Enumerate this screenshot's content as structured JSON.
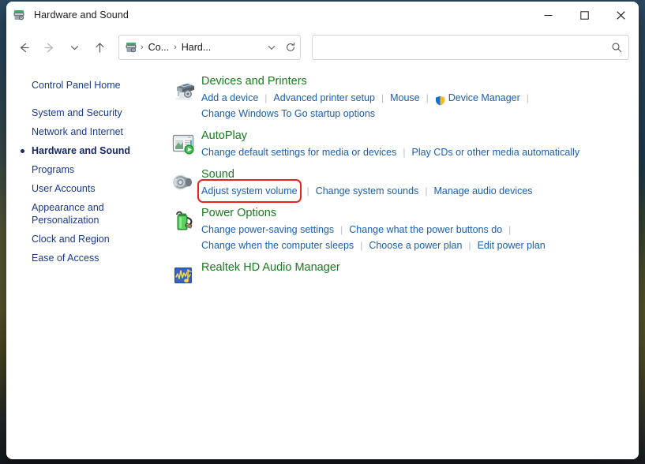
{
  "window": {
    "title": "Hardware and Sound",
    "app_icon": "printer-camera-icon",
    "controls": {
      "minimize": "—",
      "maximize": "☐",
      "close": "✕"
    }
  },
  "toolbar": {
    "back": "back-arrow",
    "forward": "forward-arrow",
    "recent": "recent-locations-chevron",
    "up": "up-arrow",
    "breadcrumb": {
      "icon": "printer-camera-icon",
      "items": [
        "Co...",
        "Hard..."
      ],
      "separator": "›",
      "chevron": "⌄",
      "refresh": "refresh-icon"
    },
    "search": {
      "value": "",
      "placeholder": "",
      "icon": "search-icon"
    }
  },
  "sidebar": {
    "items": [
      {
        "label": "Control Panel Home",
        "selected": false,
        "home": true
      },
      {
        "label": "System and Security",
        "selected": false
      },
      {
        "label": "Network and Internet",
        "selected": false
      },
      {
        "label": "Hardware and Sound",
        "selected": true
      },
      {
        "label": "Programs",
        "selected": false
      },
      {
        "label": "User Accounts",
        "selected": false
      },
      {
        "label": "Appearance and\nPersonalization",
        "selected": false
      },
      {
        "label": "Clock and Region",
        "selected": false
      },
      {
        "label": "Ease of Access",
        "selected": false
      }
    ]
  },
  "main": {
    "categories": [
      {
        "title": "Devices and Printers",
        "icon": "printer-device-icon",
        "rows": [
          [
            {
              "label": "Add a device"
            },
            {
              "label": "Advanced printer setup"
            },
            {
              "label": "Mouse"
            },
            {
              "label": "Device Manager",
              "shield": true
            }
          ],
          [
            {
              "label": "Change Windows To Go startup options"
            }
          ]
        ]
      },
      {
        "title": "AutoPlay",
        "icon": "autoplay-icon",
        "rows": [
          [
            {
              "label": "Change default settings for media or devices"
            },
            {
              "label": "Play CDs or other media automatically"
            }
          ]
        ]
      },
      {
        "title": "Sound",
        "icon": "speaker-icon",
        "rows": [
          [
            {
              "label": "Adjust system volume",
              "highlighted": true
            },
            {
              "label": "Change system sounds"
            },
            {
              "label": "Manage audio devices"
            }
          ]
        ]
      },
      {
        "title": "Power Options",
        "icon": "battery-power-icon",
        "rows": [
          [
            {
              "label": "Change power-saving settings"
            },
            {
              "label": "Change what the power buttons do"
            }
          ],
          [
            {
              "label": "Change when the computer sleeps"
            },
            {
              "label": "Choose a power plan"
            },
            {
              "label": "Edit power plan"
            }
          ]
        ]
      },
      {
        "title": "Realtek HD Audio Manager",
        "icon": "realtek-audio-icon",
        "rows": []
      }
    ]
  },
  "colors": {
    "category_title": "#1a7a1f",
    "link": "#1b5fae",
    "sidebar_link": "#1b3a8c",
    "highlight_box": "#e8231f"
  }
}
